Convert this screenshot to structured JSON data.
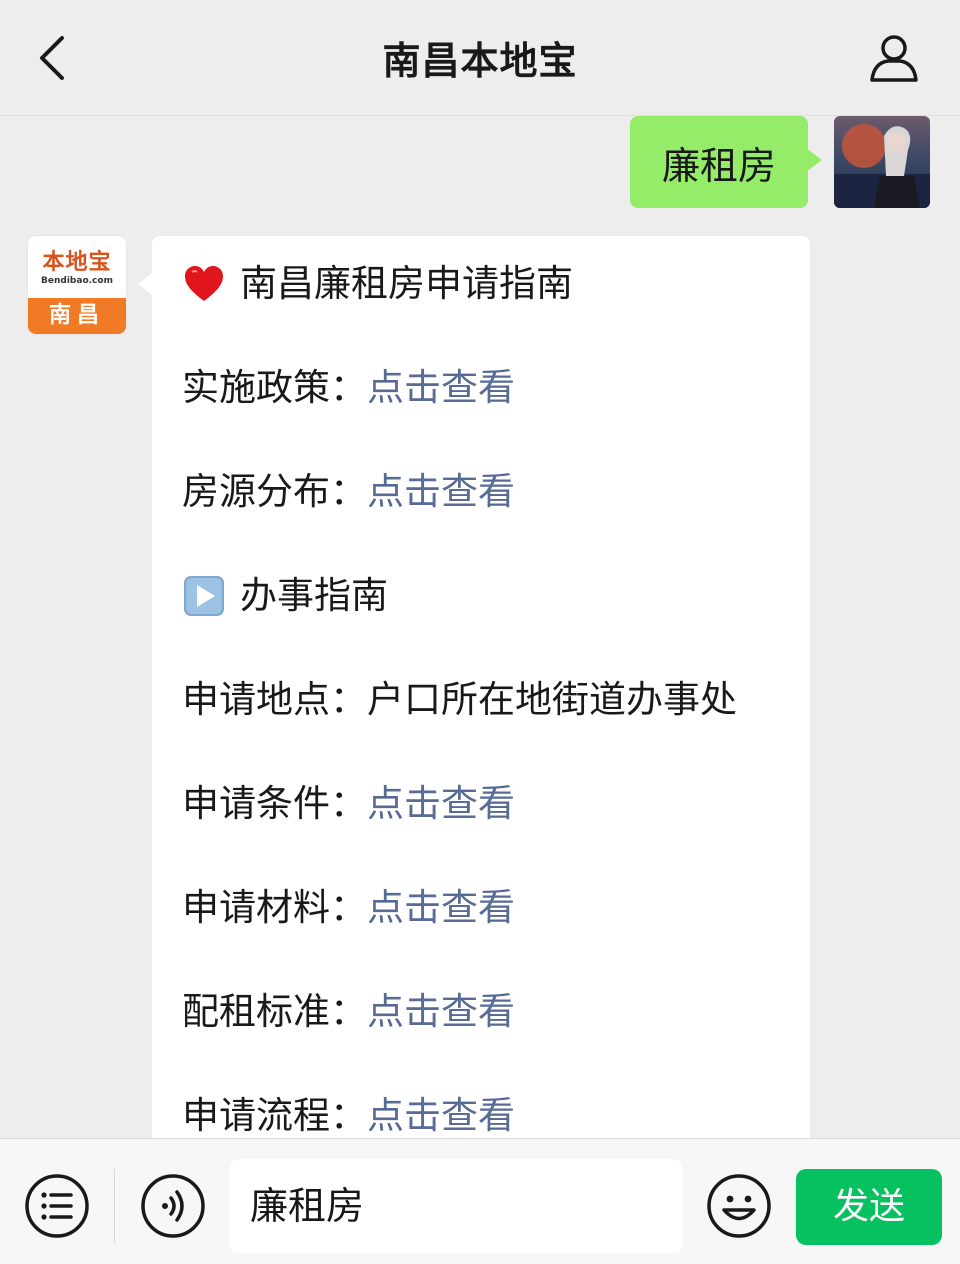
{
  "header": {
    "title": "南昌本地宝",
    "back_icon": "chevron-left-icon",
    "profile_icon": "person-icon"
  },
  "messages": {
    "sent": {
      "text": "廉租房"
    },
    "bot_avatar": {
      "logo_text": "本地宝",
      "logo_sub": "Bendibao.com",
      "city": "南昌"
    },
    "reply": {
      "title": "南昌廉租房申请指南",
      "title_icon": "heart-emoji-icon",
      "section2_title": "办事指南",
      "section2_icon": "play-button-emoji-icon",
      "rows": [
        {
          "label": "实施政策：",
          "link": "点击查看"
        },
        {
          "label": "房源分布：",
          "link": "点击查看"
        },
        {
          "label": "申请地点：",
          "value": "户口所在地街道办事处"
        },
        {
          "label": "申请条件：",
          "link": "点击查看"
        },
        {
          "label": "申请材料：",
          "link": "点击查看"
        },
        {
          "label": "配租标准：",
          "link": "点击查看"
        },
        {
          "label": "申请流程：",
          "link": "点击查看"
        }
      ]
    }
  },
  "input_bar": {
    "input_value": "廉租房",
    "send_label": "发送"
  },
  "colors": {
    "sent_bubble": "#95ec69",
    "link": "#576b95",
    "send_button": "#07c160",
    "background": "#ededed"
  }
}
